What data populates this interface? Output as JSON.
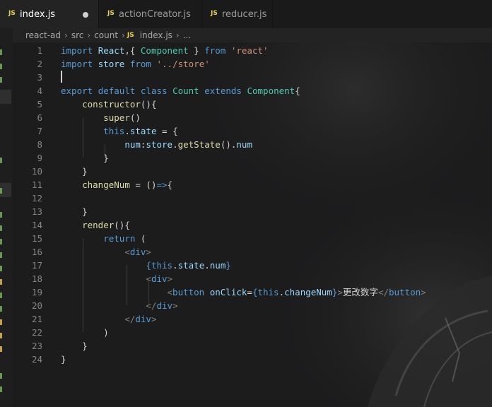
{
  "tabs": [
    {
      "icon": "JS",
      "label": "index.js",
      "active": true,
      "dirty": true
    },
    {
      "icon": "JS",
      "label": "actionCreator.js",
      "active": false,
      "dirty": false
    },
    {
      "icon": "JS",
      "label": "reducer.js",
      "active": false,
      "dirty": false
    }
  ],
  "breadcrumb": {
    "parts": [
      "react-ad",
      "src",
      "count"
    ],
    "file_icon": "JS",
    "file": "index.js",
    "tail": "..."
  },
  "code": {
    "line_numbers": [
      "1",
      "2",
      "3",
      "4",
      "5",
      "6",
      "7",
      "8",
      "9",
      "10",
      "11",
      "12",
      "13",
      "14",
      "15",
      "16",
      "17",
      "18",
      "19",
      "20",
      "21",
      "22",
      "23",
      "24"
    ],
    "lines": [
      [
        [
          "k",
          "import"
        ],
        [
          "p",
          " "
        ],
        [
          "v",
          "React"
        ],
        [
          "p",
          ",{ "
        ],
        [
          "c",
          "Component"
        ],
        [
          "p",
          " } "
        ],
        [
          "k",
          "from"
        ],
        [
          "p",
          " "
        ],
        [
          "s",
          "'react'"
        ]
      ],
      [
        [
          "k",
          "import"
        ],
        [
          "p",
          " "
        ],
        [
          "v",
          "store"
        ],
        [
          "p",
          " "
        ],
        [
          "k",
          "from"
        ],
        [
          "p",
          " "
        ],
        [
          "s",
          "'../store'"
        ]
      ],
      [],
      [
        [
          "k",
          "export"
        ],
        [
          "p",
          " "
        ],
        [
          "k",
          "default"
        ],
        [
          "p",
          " "
        ],
        [
          "k",
          "class"
        ],
        [
          "p",
          " "
        ],
        [
          "c",
          "Count"
        ],
        [
          "p",
          " "
        ],
        [
          "k",
          "extends"
        ],
        [
          "p",
          " "
        ],
        [
          "c",
          "Component"
        ],
        [
          "p",
          "{"
        ]
      ],
      [
        [
          "p",
          "    "
        ],
        [
          "f",
          "constructor"
        ],
        [
          "p",
          "(){"
        ]
      ],
      [
        [
          "p",
          "        "
        ],
        [
          "f",
          "super"
        ],
        [
          "p",
          "()"
        ]
      ],
      [
        [
          "p",
          "        "
        ],
        [
          "k",
          "this"
        ],
        [
          "p",
          "."
        ],
        [
          "v",
          "state"
        ],
        [
          "p",
          " = {"
        ]
      ],
      [
        [
          "p",
          "            "
        ],
        [
          "v",
          "num"
        ],
        [
          "p",
          ":"
        ],
        [
          "v",
          "store"
        ],
        [
          "p",
          "."
        ],
        [
          "f",
          "getState"
        ],
        [
          "p",
          "()."
        ],
        [
          "v",
          "num"
        ]
      ],
      [
        [
          "p",
          "        }"
        ]
      ],
      [
        [
          "p",
          "    }"
        ]
      ],
      [
        [
          "p",
          "    "
        ],
        [
          "f",
          "changeNum"
        ],
        [
          "p",
          " = ()"
        ],
        [
          "k",
          "=>"
        ],
        [
          "p",
          "{"
        ]
      ],
      [],
      [
        [
          "p",
          "    }"
        ]
      ],
      [
        [
          "p",
          "    "
        ],
        [
          "f",
          "render"
        ],
        [
          "p",
          "(){"
        ]
      ],
      [
        [
          "p",
          "        "
        ],
        [
          "k",
          "return"
        ],
        [
          "p",
          " ("
        ]
      ],
      [
        [
          "p",
          "            "
        ],
        [
          "t",
          "<"
        ],
        [
          "tg",
          "div"
        ],
        [
          "t",
          ">"
        ]
      ],
      [
        [
          "p",
          "                "
        ],
        [
          "k",
          "{"
        ],
        [
          "k",
          "this"
        ],
        [
          "p",
          "."
        ],
        [
          "v",
          "state"
        ],
        [
          "p",
          "."
        ],
        [
          "v",
          "num"
        ],
        [
          "k",
          "}"
        ]
      ],
      [
        [
          "p",
          "                "
        ],
        [
          "t",
          "<"
        ],
        [
          "tg",
          "div"
        ],
        [
          "t",
          ">"
        ]
      ],
      [
        [
          "p",
          "                    "
        ],
        [
          "t",
          "<"
        ],
        [
          "tg",
          "button"
        ],
        [
          "p",
          " "
        ],
        [
          "a",
          "onClick"
        ],
        [
          "p",
          "="
        ],
        [
          "k",
          "{"
        ],
        [
          "k",
          "this"
        ],
        [
          "p",
          "."
        ],
        [
          "v",
          "changeNum"
        ],
        [
          "k",
          "}"
        ],
        [
          "t",
          ">"
        ],
        [
          "tx",
          "更改数字"
        ],
        [
          "t",
          "</"
        ],
        [
          "tg",
          "button"
        ],
        [
          "t",
          ">"
        ]
      ],
      [
        [
          "p",
          "                "
        ],
        [
          "t",
          "</"
        ],
        [
          "tg",
          "div"
        ],
        [
          "t",
          ">"
        ]
      ],
      [
        [
          "p",
          "            "
        ],
        [
          "t",
          "</"
        ],
        [
          "tg",
          "div"
        ],
        [
          "t",
          ">"
        ]
      ],
      [
        [
          "p",
          "        )"
        ]
      ],
      [
        [
          "p",
          "    }"
        ]
      ],
      [
        [
          "p",
          "}"
        ]
      ]
    ]
  },
  "colors": {
    "accent_tab_icon": "#e8d44d",
    "keyword": "#569cd6",
    "identifier": "#9cdcfe",
    "class": "#4ec9b0",
    "function": "#dcdcaa",
    "string": "#ce9178",
    "git_added": "#6a9955",
    "git_modified": "#c9a04c"
  }
}
